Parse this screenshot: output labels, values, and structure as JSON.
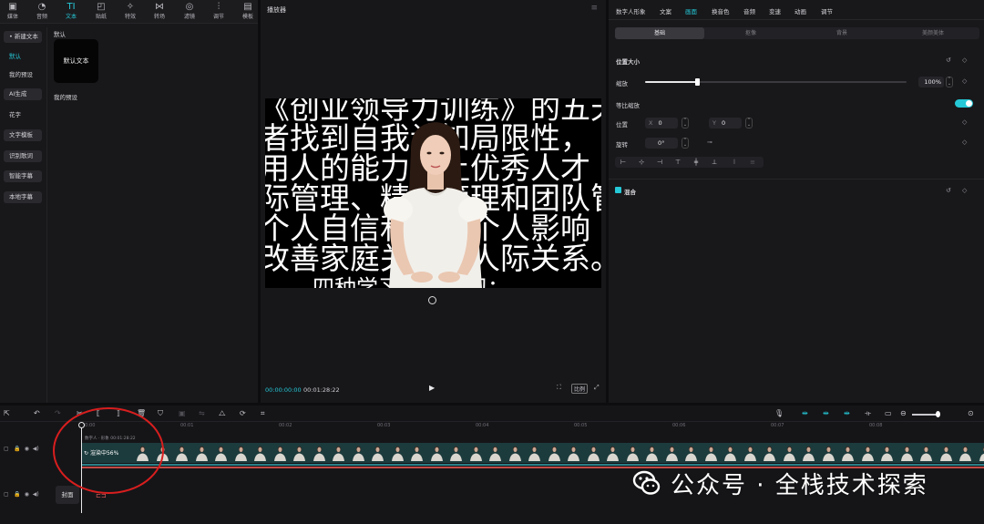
{
  "tool_tabs": [
    {
      "label": "媒体",
      "icon": "media-icon"
    },
    {
      "label": "音频",
      "icon": "audio-icon"
    },
    {
      "label": "文本",
      "icon": "text-icon",
      "active": true
    },
    {
      "label": "贴纸",
      "icon": "sticker-icon"
    },
    {
      "label": "特效",
      "icon": "effects-icon"
    },
    {
      "label": "转场",
      "icon": "transition-icon"
    },
    {
      "label": "滤镜",
      "icon": "filter-icon"
    },
    {
      "label": "调节",
      "icon": "adjust-icon"
    },
    {
      "label": "模板",
      "icon": "template-icon"
    }
  ],
  "side_menu": [
    {
      "label": "• 新建文本"
    },
    {
      "label": "默认"
    },
    {
      "label": "我的预设"
    },
    {
      "label": "AI生成"
    },
    {
      "label": "花字"
    },
    {
      "label": "文字模板"
    },
    {
      "label": "识别歌词"
    },
    {
      "label": "智能字幕"
    },
    {
      "label": "本地字幕"
    }
  ],
  "library": {
    "section_default": "默认",
    "card_label": "默认文本",
    "section_presets": "我的预设"
  },
  "player": {
    "title": "播放器",
    "overlay_lines": [
      "《创业领导力训练》的五天",
      "者找到自我认知局限性，",
      "用人的能力与让优秀人才",
      "际管理、精益管理和团队管",
      "个人自信和塑造个人影响",
      "改善家庭关系和人际关系。",
      "四种学习方式学习："
    ],
    "time_current": "00:00:00:00",
    "time_total": "00:01:28:22",
    "ratio_label": "比例"
  },
  "props": {
    "tabs": [
      {
        "label": "数字人形象"
      },
      {
        "label": "文案"
      },
      {
        "label": "画面",
        "active": true
      },
      {
        "label": "换音色"
      },
      {
        "label": "音频"
      },
      {
        "label": "变速"
      },
      {
        "label": "动画"
      },
      {
        "label": "调节"
      }
    ],
    "sub_tabs": [
      {
        "label": "基础",
        "active": true
      },
      {
        "label": "抠像"
      },
      {
        "label": "背景"
      },
      {
        "label": "美颜美体"
      }
    ],
    "section_position": "位置大小",
    "scale_label": "缩放",
    "scale_value": "100%",
    "scale_fraction": 0.2,
    "uniform_scale_label": "等比缩放",
    "position_label": "位置",
    "pos_x_axis": "X",
    "pos_x_value": "0",
    "pos_y_axis": "Y",
    "pos_y_value": "0",
    "rotate_label": "旋转",
    "rotate_value": "0°",
    "blend_label": "混合"
  },
  "timeline": {
    "ticks": [
      "00:00",
      "00:01",
      "00:02",
      "00:03",
      "00:04",
      "00:05",
      "00:06",
      "00:07",
      "00:08"
    ],
    "clip_header": "数字人 · 形象   00:01:28:22",
    "clip_status": "渲染中56%",
    "cover_label": "封面"
  },
  "watermark": {
    "text": "公众号 · 全栈技术探索"
  }
}
